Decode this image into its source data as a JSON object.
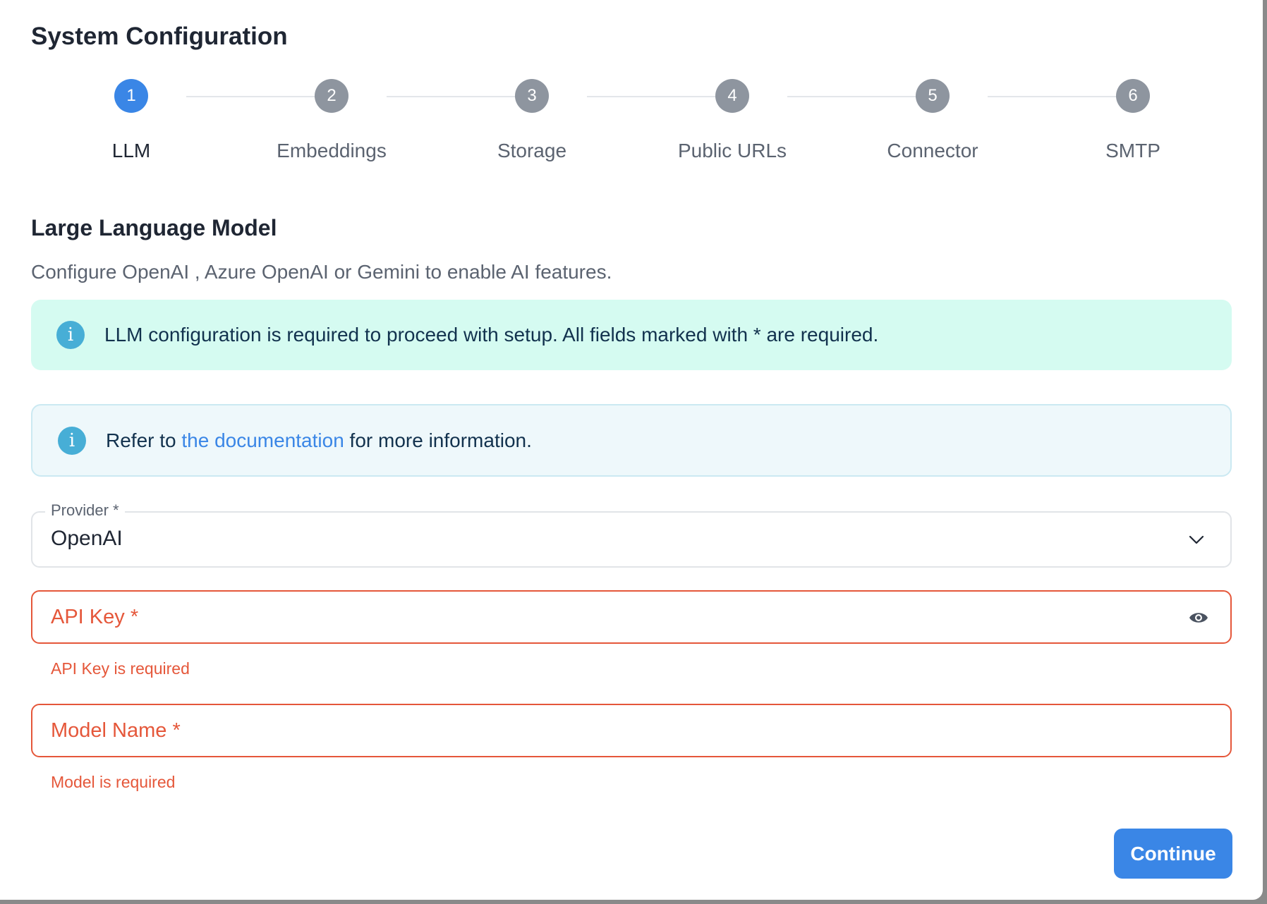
{
  "dialog": {
    "title": "System Configuration"
  },
  "stepper": {
    "active_index": 0,
    "steps": [
      {
        "number": "1",
        "label": "LLM"
      },
      {
        "number": "2",
        "label": "Embeddings"
      },
      {
        "number": "3",
        "label": "Storage"
      },
      {
        "number": "4",
        "label": "Public URLs"
      },
      {
        "number": "5",
        "label": "Connector"
      },
      {
        "number": "6",
        "label": "SMTP"
      }
    ]
  },
  "section": {
    "title": "Large Language Model",
    "description": "Configure OpenAI , Azure OpenAI or Gemini to enable AI features."
  },
  "alerts": {
    "required": {
      "icon": "info-icon",
      "text": "LLM configuration is required to proceed with setup. All fields marked with * are required."
    },
    "docs": {
      "icon": "info-icon",
      "prefix": "Refer to ",
      "link_text": "the documentation",
      "suffix": " for more information."
    }
  },
  "form": {
    "provider": {
      "label": "Provider *",
      "value": "OpenAI",
      "icon": "chevron-down-icon"
    },
    "api_key": {
      "placeholder": "API Key *",
      "error": "API Key is required",
      "icon": "eye-icon"
    },
    "model_name": {
      "placeholder": "Model Name *",
      "error": "Model is required"
    }
  },
  "actions": {
    "continue_label": "Continue"
  },
  "colors": {
    "primary": "#3a86e6",
    "error": "#e5573a",
    "step_inactive": "#8e959f",
    "alert_success_bg": "#d5fbf1",
    "alert_info_bg": "#eef8fb",
    "info_icon": "#47aed6"
  }
}
